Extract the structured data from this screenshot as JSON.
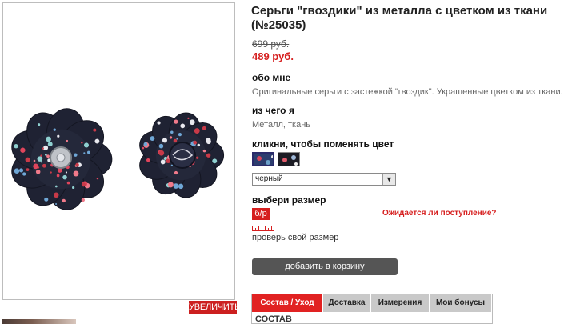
{
  "product": {
    "title": "Серьги \"гвоздики\" из металла с цветком из ткани (№25035)",
    "old_price": "699 руб.",
    "new_price": "489 руб."
  },
  "gallery": {
    "zoom_label": "УВЕЛИЧИТЬ"
  },
  "about": {
    "heading": "обо мне",
    "text": "Оригинальные серьги с застежкой \"гвоздик\". Украшенные цветком из ткани."
  },
  "material": {
    "heading": "из чего я",
    "text": "Металл, ткань"
  },
  "color": {
    "heading": "кликни, чтобы поменять цвет",
    "selected": "черный",
    "swatches": [
      "navy-floral",
      "black-floral"
    ]
  },
  "size": {
    "heading": "выбери размер",
    "option": "б/р",
    "availability_link": "Ожидается ли поступление?",
    "check_label": "проверь свой размер"
  },
  "cart": {
    "button_label": "добавить в корзину"
  },
  "tabs": {
    "items": [
      "Состав / Уход",
      "Доставка",
      "Измерения",
      "Мои бонусы"
    ],
    "active_index": 0,
    "content_heading": "СОСТАВ"
  },
  "colors": {
    "accent": "#d61f1f",
    "cart_button": "#555555",
    "tab_inactive": "#c9c9c9"
  }
}
